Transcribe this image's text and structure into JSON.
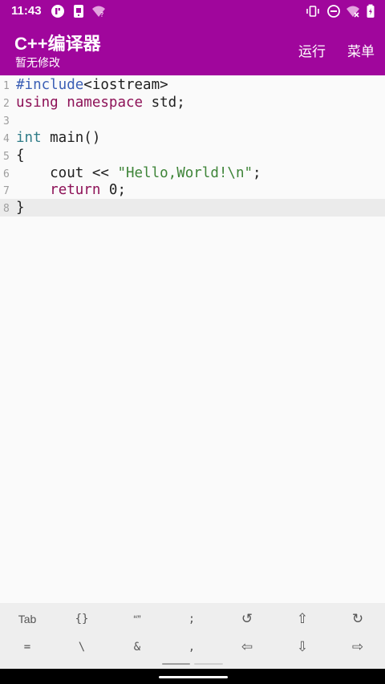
{
  "status_bar": {
    "time": "11:43",
    "left_icons": [
      "app-notification-icon",
      "sim-card-icon",
      "wifi-question-icon"
    ],
    "right_icons": [
      "vibrate-icon",
      "do-not-disturb-icon",
      "wifi-off-icon",
      "battery-icon"
    ]
  },
  "app_bar": {
    "title": "C++编译器",
    "subtitle": "暂无修改",
    "actions": {
      "run": "运行",
      "menu": "菜单"
    },
    "background": "#a0069c"
  },
  "editor": {
    "current_line": 8,
    "line_numbers": [
      "1",
      "2",
      "3",
      "4",
      "5",
      "6",
      "7",
      "8"
    ],
    "lines": [
      {
        "tokens": [
          {
            "t": "#include",
            "k": "pre"
          },
          {
            "t": "<iostream>",
            "k": "plain"
          }
        ]
      },
      {
        "tokens": [
          {
            "t": "using",
            "k": "kw"
          },
          {
            "t": " ",
            "k": "plain"
          },
          {
            "t": "namespace",
            "k": "kw"
          },
          {
            "t": " std;",
            "k": "plain"
          }
        ]
      },
      {
        "tokens": []
      },
      {
        "tokens": [
          {
            "t": "int",
            "k": "type"
          },
          {
            "t": " main()",
            "k": "plain"
          }
        ]
      },
      {
        "tokens": [
          {
            "t": "{",
            "k": "plain"
          }
        ]
      },
      {
        "tokens": [
          {
            "t": "    cout << ",
            "k": "plain"
          },
          {
            "t": "\"Hello,World!\\n\"",
            "k": "str"
          },
          {
            "t": ";",
            "k": "plain"
          }
        ]
      },
      {
        "tokens": [
          {
            "t": "    ",
            "k": "plain"
          },
          {
            "t": "return",
            "k": "kw"
          },
          {
            "t": " 0;",
            "k": "plain"
          }
        ]
      },
      {
        "tokens": [
          {
            "t": "}",
            "k": "plain"
          }
        ]
      }
    ],
    "colors": {
      "preprocessor": "#3b5fb5",
      "keyword": "#8d1157",
      "type": "#2f7c88",
      "string": "#3e8438"
    }
  },
  "keybar": {
    "row1": [
      "Tab",
      "{}",
      "“”",
      ";",
      "↺",
      "⇧",
      "↻"
    ],
    "row2": [
      "=",
      "\\",
      "&",
      ",",
      "⇦",
      "⇩",
      "⇨"
    ],
    "row1_names": [
      "tab-key",
      "braces-key",
      "quotes-key",
      "semicolon-key",
      "undo-icon",
      "arrow-up-icon",
      "redo-icon"
    ],
    "row2_names": [
      "equals-key",
      "backslash-key",
      "ampersand-key",
      "comma-key",
      "arrow-left-icon",
      "arrow-down-icon",
      "arrow-right-icon"
    ]
  }
}
